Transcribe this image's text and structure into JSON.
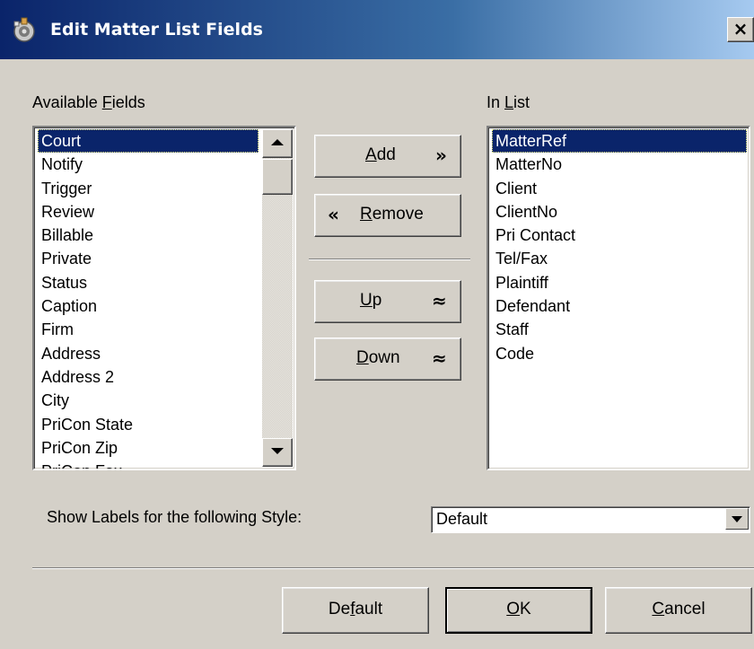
{
  "window": {
    "title": "Edit Matter List Fields",
    "close_glyph": "×"
  },
  "available": {
    "label_pre": "Available ",
    "label_key": "F",
    "label_post": "ields",
    "items": [
      "Court",
      "Notify",
      "Trigger",
      "Review",
      "Billable",
      "Private",
      "Status",
      "Caption",
      "Firm",
      "Address",
      "Address 2",
      "City",
      "PriCon State",
      "PriCon Zip",
      "PriCon Fax"
    ],
    "selected": "Court"
  },
  "inlist": {
    "label_pre": "In ",
    "label_key": "L",
    "label_post": "ist",
    "items": [
      "MatterRef",
      "MatterNo",
      "Client",
      "ClientNo",
      "Pri Contact",
      "Tel/Fax",
      "Plaintiff",
      "Defendant",
      "Staff",
      "Code"
    ],
    "selected": "MatterRef"
  },
  "buttons": {
    "add": {
      "key": "A",
      "rest": "dd",
      "glyph": "»"
    },
    "remove": {
      "key": "R",
      "rest": "emove",
      "glyph": "«"
    },
    "up": {
      "key": "U",
      "rest": "p",
      "glyph": "≈"
    },
    "down": {
      "key": "D",
      "rest": "own",
      "glyph": "≈"
    }
  },
  "style_row": {
    "label": "Show Labels for the following Style:",
    "value": "Default"
  },
  "footer": {
    "default": {
      "pre": "De",
      "key": "f",
      "post": "ault"
    },
    "ok": {
      "pre": "",
      "key": "O",
      "post": "K"
    },
    "cancel": {
      "pre": "",
      "key": "C",
      "post": "ancel"
    }
  },
  "icons": {
    "app": "app-icon",
    "scroll_up": "chevron-up-icon",
    "scroll_down": "chevron-down-icon",
    "combo_drop": "chevron-down-icon"
  },
  "colors": {
    "title_start": "#0a246a",
    "title_end": "#a6caf0",
    "face": "#d4d0c8",
    "selection": "#0a246a"
  }
}
